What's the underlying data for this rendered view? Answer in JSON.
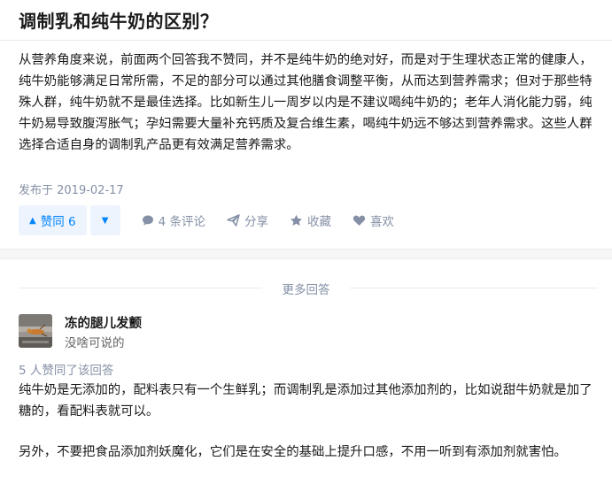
{
  "question": {
    "title": "调制乳和纯牛奶的区别？"
  },
  "answer": {
    "text": "从营养角度来说，前面两个回答我不赞同，并不是纯牛奶的绝对好，而是对于生理状态正常的健康人，纯牛奶能够满足日常所需，不足的部分可以通过其他膳食调整平衡，从而达到营养需求；但对于那些特殊人群，纯牛奶就不是最佳选择。比如新生儿一周岁以内是不建议喝纯牛奶的；老年人消化能力弱，纯牛奶易导致腹泻胀气；孕妇需要大量补充钙质及复合维生素，喝纯牛奶远不够达到营养需求。这些人群选择合适自身的调制乳产品更有效满足营养需求。",
    "date": "发布于 2019-02-17",
    "actions": {
      "upvote_label": "赞同 6",
      "comments_label": "4 条评论",
      "share_label": "分享",
      "favorite_label": "收藏",
      "like_label": "喜欢"
    }
  },
  "more_answers": {
    "label": "更多回答",
    "author": {
      "name": "冻的腿儿发颤",
      "bio": "没啥可说的"
    },
    "vote_count": "5 人赞同了该回答",
    "paragraphs": [
      "纯牛奶是无添加的，配料表只有一个生鲜乳；而调制乳是添加过其他添加剂的，比如说甜牛奶就是加了糖的，看配料表就可以。",
      "另外，不要把食品添加剂妖魔化，它们是在安全的基础上提升口感，不用一听到有添加剂就害怕。"
    ]
  },
  "colors": {
    "accent": "#0084ff",
    "accent_bg": "#eef4fd",
    "meta": "#8590a6",
    "background": "#f6f6f6"
  },
  "icons": {
    "upvote": "triangle-up-icon",
    "downvote": "triangle-down-icon",
    "comment": "comment-bubble-icon",
    "share": "paper-plane-icon",
    "favorite": "star-icon",
    "like": "heart-icon"
  }
}
